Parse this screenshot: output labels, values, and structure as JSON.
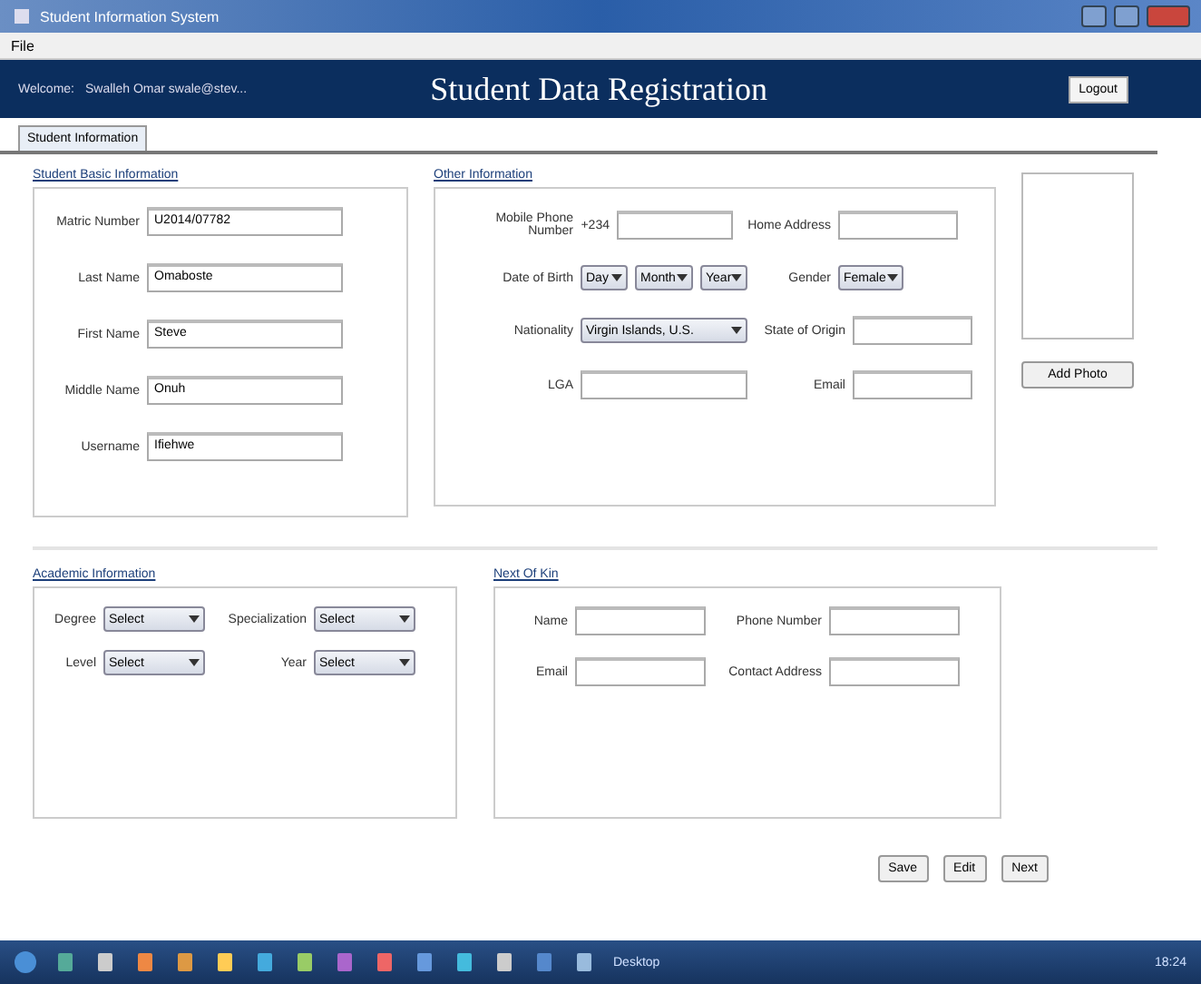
{
  "window": {
    "title": "Student Information System"
  },
  "menu": [
    "File"
  ],
  "header": {
    "welcome_label": "Welcome:",
    "user": "Swalleh Omar swale@stev...",
    "title": "Student Data Registration",
    "logout": "Logout"
  },
  "tabs": [
    {
      "label": "Student Information",
      "selected": true
    }
  ],
  "basic_info": {
    "title": "Student Basic Information",
    "fields": [
      {
        "label": "Matric Number",
        "value": "U2014/07782"
      },
      {
        "label": "Last Name",
        "value": "Omaboste"
      },
      {
        "label": "First Name",
        "value": "Steve"
      },
      {
        "label": "Middle Name",
        "value": "Onuh"
      },
      {
        "label": "Username",
        "value": "Ifiehwe"
      }
    ]
  },
  "other_info": {
    "title": "Other Information",
    "phone_label": "Mobile Phone Number",
    "phone_prefix": "+234",
    "home_address_label": "Home Address",
    "dob_label": "Date of Birth",
    "dob": [
      "Day",
      "Month",
      "Year"
    ],
    "gender_label": "Gender",
    "gender": "Female",
    "nationality_label": "Nationality",
    "nationality": "Virgin Islands, U.S.",
    "state_label": "State of Origin",
    "lga_label": "LGA",
    "email_label": "Email"
  },
  "photo": {
    "button": "Add Photo"
  },
  "academic": {
    "title": "Academic Information",
    "fields": [
      {
        "label": "Degree",
        "value": "Select"
      },
      {
        "label": "Specialization",
        "value": "Select"
      },
      {
        "label": "Level",
        "value": "Select"
      },
      {
        "label": "Year",
        "value": "Select"
      }
    ]
  },
  "next_of_kin": {
    "title": "Next Of Kin",
    "fields": [
      {
        "label": "Name"
      },
      {
        "label": "Phone Number"
      },
      {
        "label": "Email"
      },
      {
        "label": "Contact Address"
      }
    ]
  },
  "buttons": [
    "Save",
    "Edit",
    "Next"
  ],
  "taskbar": {
    "desktop": "Desktop",
    "clock": "18:24"
  }
}
